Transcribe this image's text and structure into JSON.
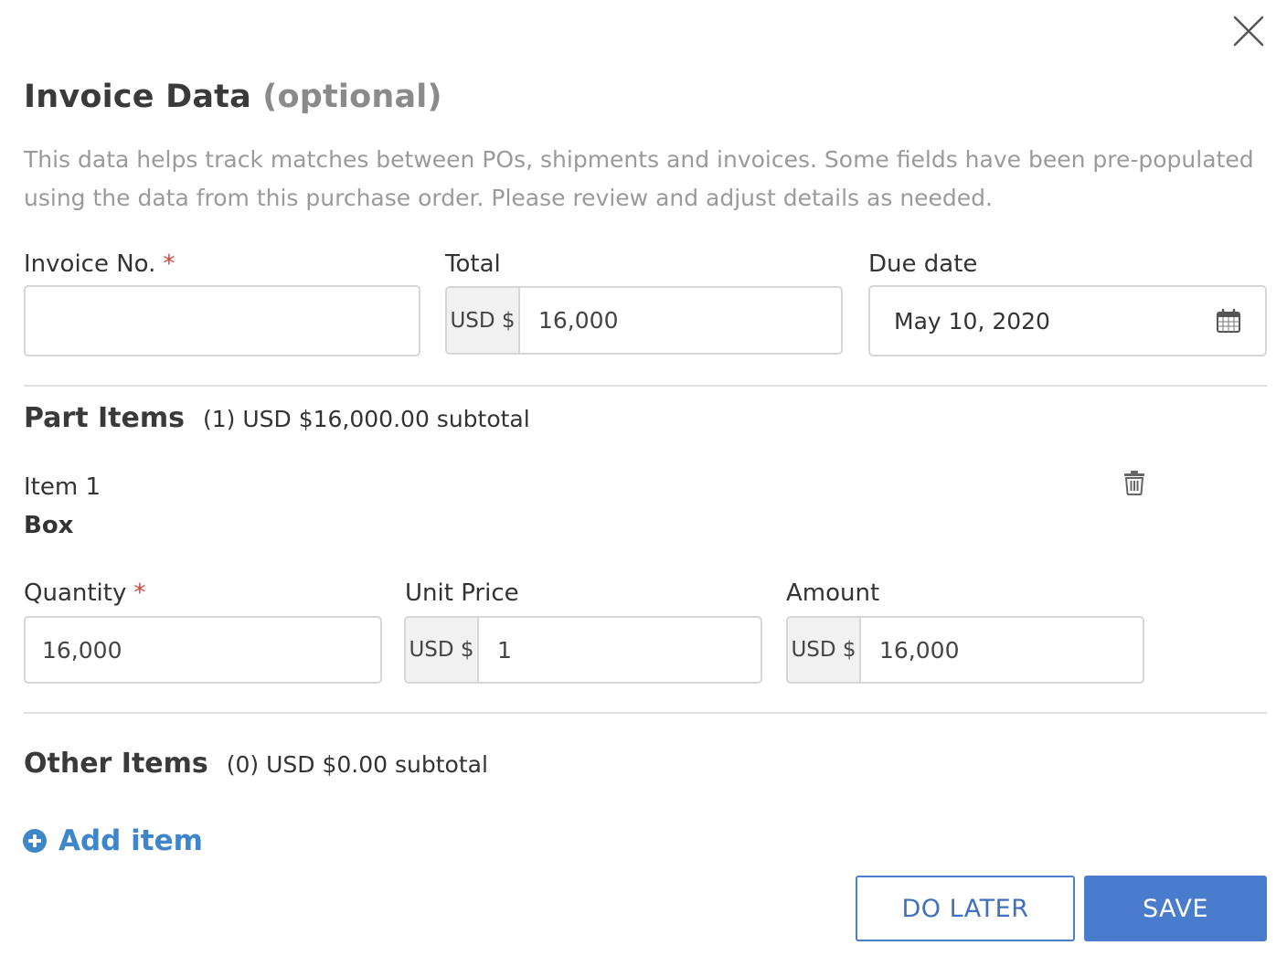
{
  "dialog": {
    "title": "Invoice Data",
    "title_optional": "(optional)",
    "description": "This data helps track matches between POs, shipments and invoices. Some fields have been pre-populated using the data from this purchase order. Please review and adjust details as needed."
  },
  "invoice": {
    "invoice_no_label": "Invoice No.",
    "required_mark": "*",
    "invoice_no_value": "",
    "total_label": "Total",
    "total_currency": "USD $",
    "total_value": "16,000",
    "due_date_label": "Due date",
    "due_date_value": "May 10, 2020"
  },
  "part_items": {
    "title": "Part Items",
    "subtitle": "(1) USD $16,000.00 subtotal",
    "items": [
      {
        "index_label": "Item 1",
        "name": "Box",
        "quantity_label": "Quantity",
        "required_mark": "*",
        "quantity_value": "16,000",
        "unit_price_label": "Unit Price",
        "unit_price_currency": "USD $",
        "unit_price_value": "1",
        "amount_label": "Amount",
        "amount_currency": "USD $",
        "amount_value": "16,000"
      }
    ]
  },
  "other_items": {
    "title": "Other Items",
    "subtitle": "(0) USD $0.00 subtotal",
    "add_item_label": "Add item"
  },
  "actions": {
    "do_later_label": "DO LATER",
    "save_label": "SAVE"
  },
  "icons": {
    "close": "close-icon",
    "calendar": "calendar-icon",
    "trash": "trash-icon",
    "add": "plus-circle-icon"
  },
  "colors": {
    "accent": "#4a7ccd",
    "link": "#3f86c8",
    "required": "#d0453f",
    "muted_text": "#9a9a9a"
  }
}
